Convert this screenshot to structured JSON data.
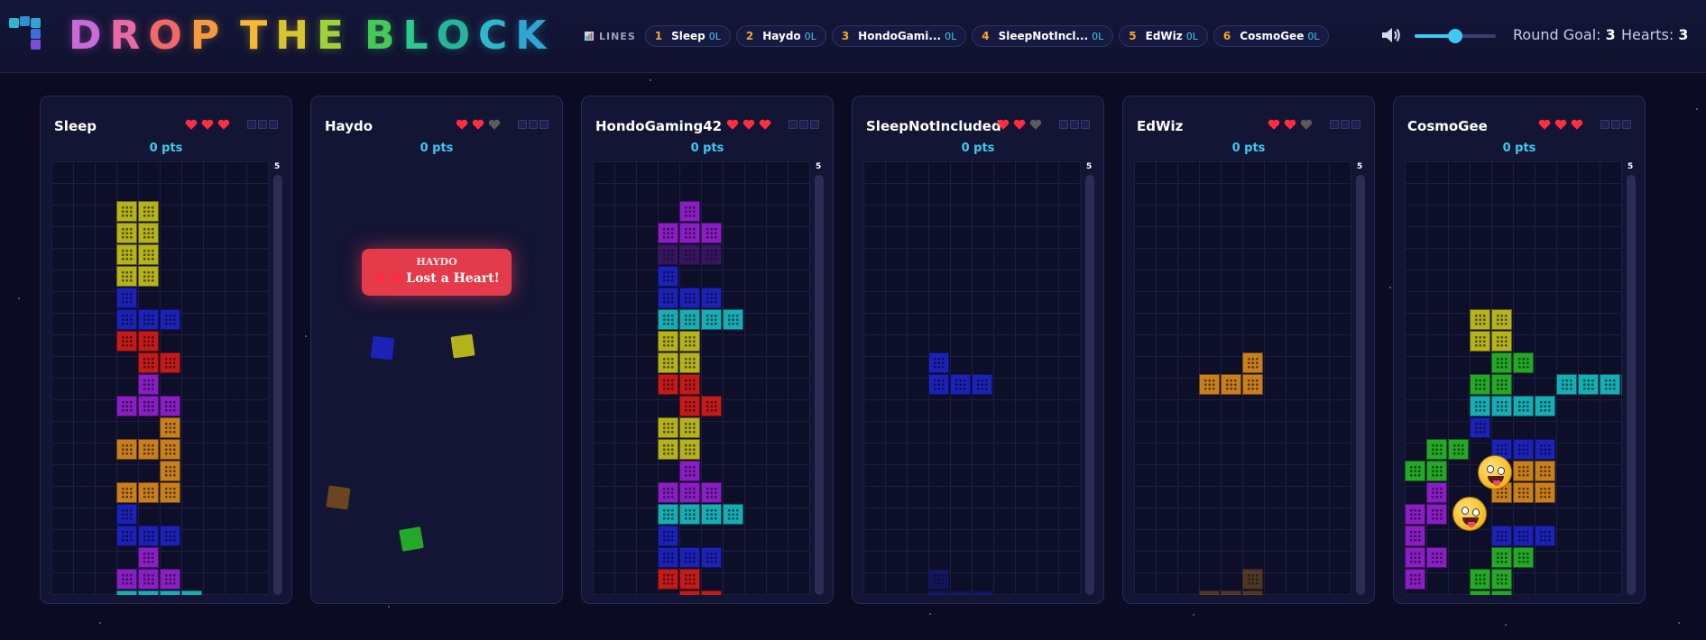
{
  "header": {
    "logo_letters": [
      "D",
      "R",
      "O",
      "P",
      " ",
      "T",
      "H",
      "E",
      " ",
      "B",
      "L",
      "O",
      "C",
      "K"
    ],
    "logo_colors": [
      "#c96bd6",
      "#e86aa6",
      "#f06a6a",
      "#f59a3e",
      "",
      "#f6b934",
      "#d9c52e",
      "#9fd23a",
      "",
      "#47c95a",
      "#2ec98c",
      "#26b59a",
      "#2fb8c9",
      "#2fa6cf"
    ],
    "lines_label": "LINES",
    "chips": [
      {
        "rank": "1",
        "name": "Sleep",
        "lines": "0L"
      },
      {
        "rank": "2",
        "name": "Haydo",
        "lines": "0L"
      },
      {
        "rank": "3",
        "name": "HondoGami...",
        "lines": "0L"
      },
      {
        "rank": "4",
        "name": "SleepNotIncl...",
        "lines": "0L"
      },
      {
        "rank": "5",
        "name": "EdWiz",
        "lines": "0L"
      },
      {
        "rank": "6",
        "name": "CosmoGee",
        "lines": "0L"
      }
    ],
    "volume_icon": "speaker-icon",
    "volume_level": 0.5,
    "round_goal_label": "Round Goal:",
    "round_goal_value": "3",
    "hearts_label": "Hearts:",
    "hearts_value": "3"
  },
  "colors": {
    "Y": "#b5b21c",
    "B": "#1c22b8",
    "R": "#c41a1a",
    "P": "#8a1ec4",
    "O": "#c9801c",
    "C": "#16aeb5",
    "G": "#24a828",
    "heart_full": "#ff2d3d",
    "heart_empty": "#5a5a5a",
    "accent": "#3ec9f0"
  },
  "boards": [
    {
      "name": "Sleep",
      "pts": "0 pts",
      "hearts": [
        true,
        true,
        true
      ],
      "next": "5",
      "rows": [
        "..........",
        "..........",
        "...YY.....",
        "...YY.....",
        "...YY.....",
        "...YY.....",
        "...B......",
        "...BBB....",
        "...RR.....",
        "....RR....",
        "....P.....",
        "...PPP....",
        ".....O....",
        "...OOO....",
        ".....O....",
        "...OOO....",
        "...B......",
        "...BBB....",
        "....P.....",
        "...PPP....",
        "...CCCC..."
      ]
    },
    {
      "name": "Haydo",
      "pts": "0 pts",
      "hearts": [
        true,
        true,
        false
      ],
      "next": "",
      "rows": [],
      "alert_name": "HAYDO",
      "alert_message": "Lost a Heart!"
    },
    {
      "name": "HondoGaming42",
      "pts": "0 pts",
      "hearts": [
        true,
        true,
        true
      ],
      "next": "5",
      "rows": [
        "..........",
        "..........",
        "....P.....",
        "...PPP....",
        "...ppp....",
        "...B......",
        "...BBB....",
        "...CCCC...",
        "...YY.....",
        "...YY.....",
        "...RR.....",
        "....RR....",
        "...YY.....",
        "...YY.....",
        "....P.....",
        "...PPP....",
        "...CCCC...",
        "...B......",
        "...BBB....",
        "...RR.....",
        "....RR...."
      ]
    },
    {
      "name": "SleepNotIncluded",
      "pts": "0 pts",
      "hearts": [
        true,
        true,
        false
      ],
      "next": "5",
      "rows": [
        "..........",
        "..........",
        "..........",
        "..........",
        "..........",
        "..........",
        "..........",
        "..........",
        "..........",
        "...B......",
        "...BBB....",
        "..........",
        "..........",
        "..........",
        "..........",
        "..........",
        "..........",
        "..........",
        "..........",
        "...b......",
        "...bbb...."
      ]
    },
    {
      "name": "EdWiz",
      "pts": "0 pts",
      "hearts": [
        true,
        true,
        false
      ],
      "next": "5",
      "rows": [
        "..........",
        "..........",
        "..........",
        "..........",
        "..........",
        "..........",
        "..........",
        "..........",
        "..........",
        ".....O....",
        "...OOO....",
        "..........",
        "..........",
        "..........",
        "..........",
        "..........",
        "..........",
        "..........",
        "..........",
        ".....o....",
        "...ooo...."
      ]
    },
    {
      "name": "CosmoGee",
      "pts": "0 pts",
      "hearts": [
        true,
        true,
        true
      ],
      "next": "5",
      "rows": [
        "..........",
        "..........",
        "..........",
        "..........",
        "..........",
        "..........",
        "..........",
        "...YY.....",
        "...YY.....",
        "....GG....",
        "...GG..CCCC",
        "...CCCC...",
        "...B......",
        ".GG.BBB...",
        "GG...OO...",
        ".P..OOO...",
        "PP........",
        "P...BBB...",
        "PP..GG....",
        "P..GG.....",
        "...GG....."
      ]
    }
  ]
}
